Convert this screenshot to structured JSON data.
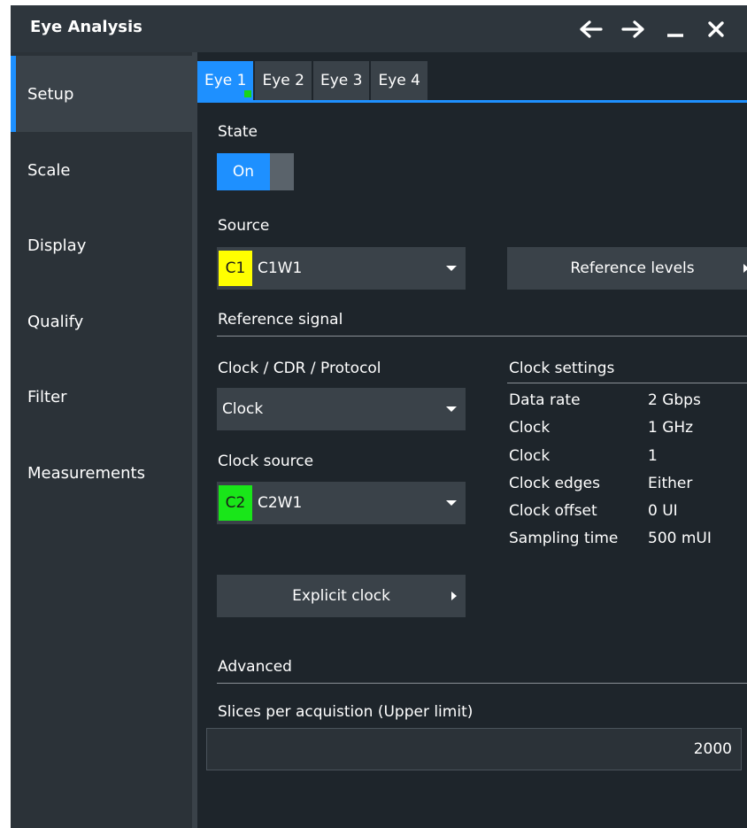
{
  "window": {
    "title": "Eye Analysis"
  },
  "sidebar": {
    "items": [
      {
        "label": "Setup",
        "active": true
      },
      {
        "label": "Scale"
      },
      {
        "label": "Display"
      },
      {
        "label": "Qualify"
      },
      {
        "label": "Filter"
      },
      {
        "label": "Measurements"
      }
    ]
  },
  "tabs": [
    {
      "label": "Eye 1",
      "active": true
    },
    {
      "label": "Eye 2"
    },
    {
      "label": "Eye 3"
    },
    {
      "label": "Eye 4"
    }
  ],
  "state": {
    "label": "State",
    "toggle_value": "On"
  },
  "source": {
    "label": "Source",
    "chip": "C1",
    "chip_color": "#ffff00",
    "value": "C1W1"
  },
  "reference_levels_button": "Reference levels",
  "reference_signal": {
    "heading": "Reference signal",
    "mode_label": "Clock / CDR / Protocol",
    "mode_value": "Clock",
    "clock_source_label": "Clock source",
    "clock_source_chip": "C2",
    "clock_source_chip_color": "#19e619",
    "clock_source_value": "C2W1",
    "explicit_clock_button": "Explicit clock"
  },
  "clock_settings": {
    "heading": "Clock settings",
    "rows": [
      {
        "key": "Data rate",
        "value": "2 Gbps"
      },
      {
        "key": "Clock",
        "value": "1 GHz"
      },
      {
        "key": "Clock",
        "value": "1"
      },
      {
        "key": "Clock edges",
        "value": "Either"
      },
      {
        "key": "Clock offset",
        "value": "0 UI"
      },
      {
        "key": "Sampling time",
        "value": "500 mUI"
      }
    ]
  },
  "advanced": {
    "heading": "Advanced",
    "slices_label": "Slices per acquistion (Upper limit)",
    "slices_value": "2000"
  },
  "colors": {
    "accent": "#1e90ff",
    "panel": "#1e252b",
    "control": "#3a4249"
  }
}
